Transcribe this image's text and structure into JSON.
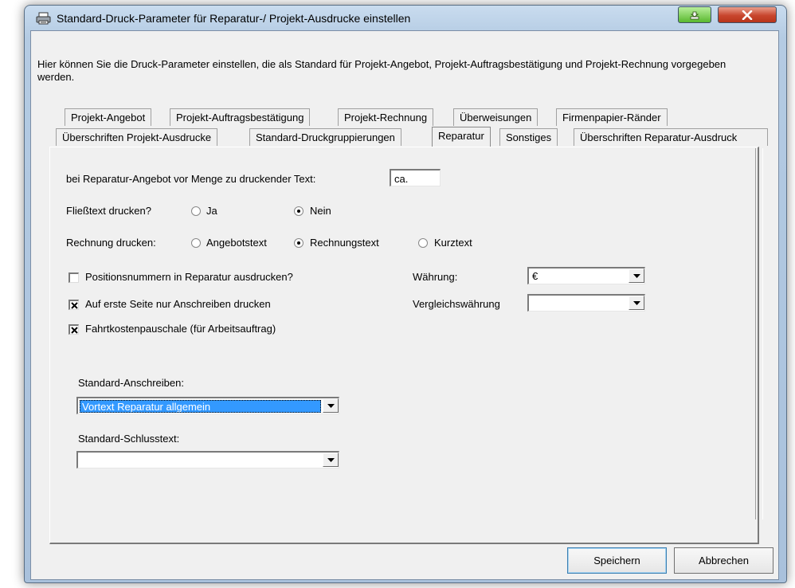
{
  "window": {
    "title": "Standard-Druck-Parameter für Reparatur-/ Projekt-Ausdrucke einstellen"
  },
  "description": "Hier können Sie die Druck-Parameter einstellen, die als Standard für Projekt-Angebot, Projekt-Auftragsbestätigung und Projekt-Rechnung vorgegeben werden.",
  "tabs_row1": [
    {
      "label": "Projekt-Angebot"
    },
    {
      "label": "Projekt-Auftragsbestätigung"
    },
    {
      "label": "Projekt-Rechnung"
    },
    {
      "label": "Überweisungen"
    },
    {
      "label": "Firmenpapier-Ränder"
    }
  ],
  "tabs_row2": [
    {
      "label": "Überschriften Projekt-Ausdrucke"
    },
    {
      "label": "Standard-Druckgruppierungen"
    },
    {
      "label": "Reparatur",
      "active": true
    },
    {
      "label": "Sonstiges"
    },
    {
      "label": "Überschriften Reparatur-Ausdruck"
    }
  ],
  "form": {
    "menge_text_label": "bei Reparatur-Angebot vor Menge zu druckender Text:",
    "menge_text_value": "ca.",
    "fliesstext_label": "Fließtext drucken?",
    "fliesstext_options": [
      "Ja",
      "Nein"
    ],
    "fliesstext_selected": "Nein",
    "rechnung_label": "Rechnung drucken:",
    "rechnung_options": [
      "Angebotstext",
      "Rechnungstext",
      "Kurztext"
    ],
    "rechnung_selected": "Rechnungstext",
    "checkbox_positionsnummern": {
      "label": "Positionsnummern in Reparatur ausdrucken?",
      "checked": false
    },
    "checkbox_erste_seite": {
      "label": "Auf erste Seite nur Anschreiben drucken",
      "checked": true
    },
    "checkbox_fahrtkosten": {
      "label": "Fahrtkostenpauschale (für Arbeitsauftrag)",
      "checked": true
    },
    "waehrung_label": "Währung:",
    "waehrung_value": "€",
    "vergleichswaehrung_label": "Vergleichswährung",
    "vergleichswaehrung_value": "",
    "anschreiben_label": "Standard-Anschreiben:",
    "anschreiben_value": "Vortext Reparatur allgemein",
    "schlusstext_label": "Standard-Schlusstext:",
    "schlusstext_value": ""
  },
  "buttons": {
    "save": "Speichern",
    "cancel": "Abbrechen"
  }
}
